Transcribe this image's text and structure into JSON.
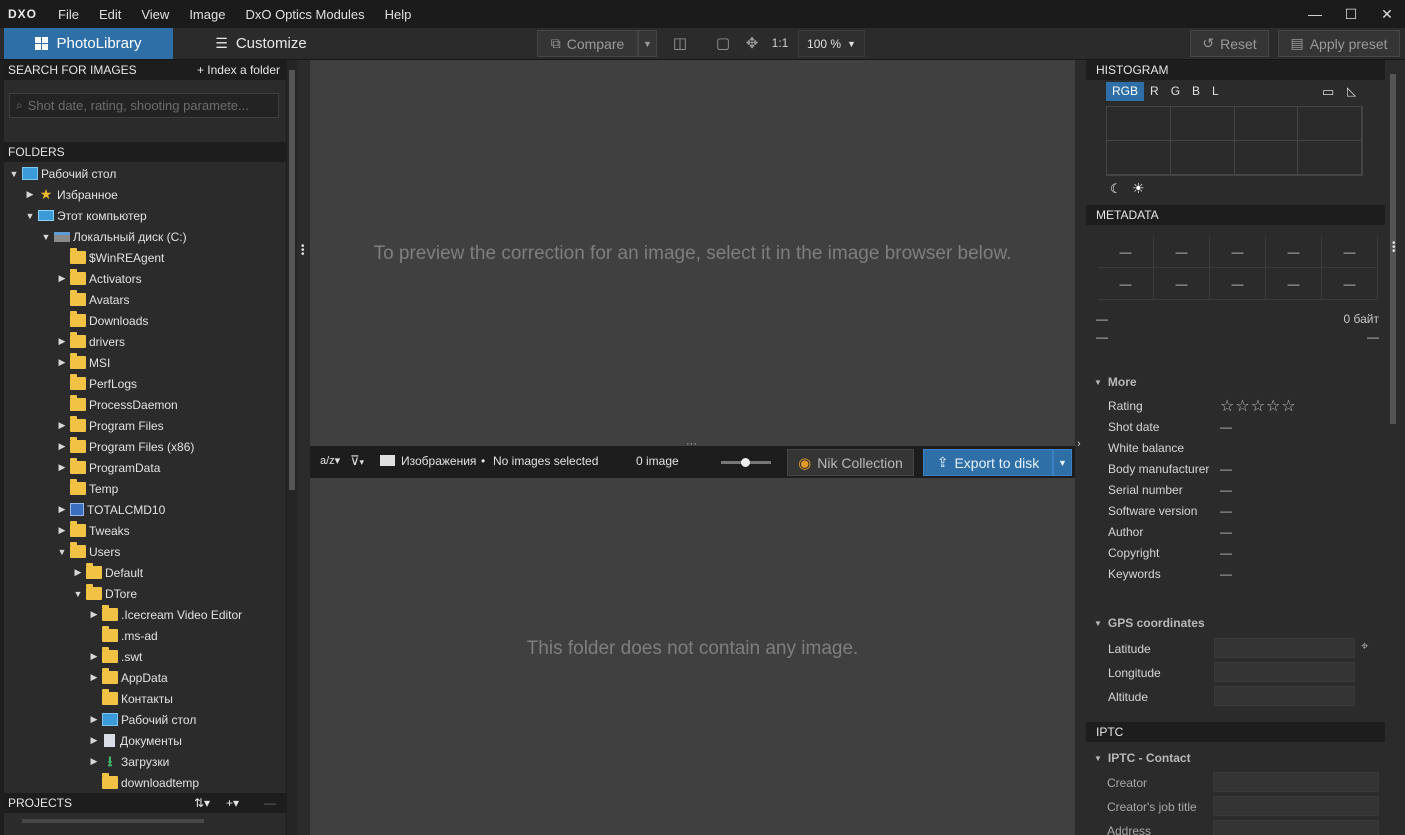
{
  "app": {
    "logo": "DXO"
  },
  "menu": [
    "File",
    "Edit",
    "View",
    "Image",
    "DxO Optics Modules",
    "Help"
  ],
  "window_controls": {
    "minimize": "—",
    "maximize": "☐",
    "close": "✕"
  },
  "toolbar": {
    "tab_photolibrary": "PhotoLibrary",
    "tab_customize": "Customize",
    "compare": "Compare",
    "zoom_1to1": "1:1",
    "zoom_level": "100 %",
    "reset": "Reset",
    "apply_preset": "Apply preset"
  },
  "left": {
    "search_header": "SEARCH FOR IMAGES",
    "index_folder": "+ Index a folder",
    "search_placeholder": "Shot date, rating, shooting paramete...",
    "folders_header": "FOLDERS",
    "tree": [
      {
        "label": "Рабочий стол",
        "indent": 0,
        "toggle": "open",
        "icon": "desktop"
      },
      {
        "label": "Избранное",
        "indent": 1,
        "toggle": "closed",
        "icon": "star"
      },
      {
        "label": "Этот компьютер",
        "indent": 1,
        "toggle": "open",
        "icon": "monitor"
      },
      {
        "label": "Локальный диск (C:)",
        "indent": 2,
        "toggle": "open",
        "icon": "drive"
      },
      {
        "label": "$WinREAgent",
        "indent": 3,
        "toggle": "none",
        "icon": "folder"
      },
      {
        "label": "Activators",
        "indent": 3,
        "toggle": "closed",
        "icon": "folder"
      },
      {
        "label": "Avatars",
        "indent": 3,
        "toggle": "none",
        "icon": "folder"
      },
      {
        "label": "Downloads",
        "indent": 3,
        "toggle": "none",
        "icon": "folder"
      },
      {
        "label": "drivers",
        "indent": 3,
        "toggle": "closed",
        "icon": "folder"
      },
      {
        "label": "MSI",
        "indent": 3,
        "toggle": "closed",
        "icon": "folder"
      },
      {
        "label": "PerfLogs",
        "indent": 3,
        "toggle": "none",
        "icon": "folder"
      },
      {
        "label": "ProcessDaemon",
        "indent": 3,
        "toggle": "none",
        "icon": "folder"
      },
      {
        "label": "Program Files",
        "indent": 3,
        "toggle": "closed",
        "icon": "folder"
      },
      {
        "label": "Program Files (x86)",
        "indent": 3,
        "toggle": "closed",
        "icon": "folder"
      },
      {
        "label": "ProgramData",
        "indent": 3,
        "toggle": "closed",
        "icon": "folder"
      },
      {
        "label": "Temp",
        "indent": 3,
        "toggle": "none",
        "icon": "folder"
      },
      {
        "label": "TOTALCMD10",
        "indent": 3,
        "toggle": "closed",
        "icon": "floppy"
      },
      {
        "label": "Tweaks",
        "indent": 3,
        "toggle": "closed",
        "icon": "folder"
      },
      {
        "label": "Users",
        "indent": 3,
        "toggle": "open",
        "icon": "folder"
      },
      {
        "label": "Default",
        "indent": 4,
        "toggle": "closed",
        "icon": "folder"
      },
      {
        "label": "DTore",
        "indent": 4,
        "toggle": "open",
        "icon": "folder"
      },
      {
        "label": ".Icecream Video Editor",
        "indent": 5,
        "toggle": "closed",
        "icon": "folder"
      },
      {
        "label": ".ms-ad",
        "indent": 5,
        "toggle": "none",
        "icon": "folder"
      },
      {
        "label": ".swt",
        "indent": 5,
        "toggle": "closed",
        "icon": "folder"
      },
      {
        "label": "AppData",
        "indent": 5,
        "toggle": "closed",
        "icon": "folder"
      },
      {
        "label": "Контакты",
        "indent": 5,
        "toggle": "none",
        "icon": "folder"
      },
      {
        "label": "Рабочий стол",
        "indent": 5,
        "toggle": "closed",
        "icon": "desktop"
      },
      {
        "label": "Документы",
        "indent": 5,
        "toggle": "closed",
        "icon": "doc"
      },
      {
        "label": "Загрузки",
        "indent": 5,
        "toggle": "closed",
        "icon": "download"
      },
      {
        "label": "downloadtemp",
        "indent": 5,
        "toggle": "none",
        "icon": "folder"
      }
    ],
    "projects_header": "PROJECTS",
    "projects_sort": "⇅▾",
    "projects_add": "+▾",
    "projects_remove": "—"
  },
  "viewer": {
    "message": "To preview the correction for an image, select it in the image browser below."
  },
  "browser_toolbar": {
    "sort": "a/z▾",
    "filter": "▾",
    "folder_name": "Изображения",
    "bullet": "•",
    "selection": "No images selected",
    "image_count": "0 image",
    "nik": "Nik Collection",
    "export": "Export to disk"
  },
  "browser": {
    "message": "This folder does not contain any image."
  },
  "right": {
    "histogram_header": "HISTOGRAM",
    "hist_tabs": [
      "RGB",
      "R",
      "G",
      "B",
      "L"
    ],
    "metadata_header": "METADATA",
    "meta_grid": [
      "—",
      "—",
      "—",
      "—",
      "—",
      "—",
      "—",
      "—",
      "—",
      "—"
    ],
    "file_name": "—",
    "file_size": "0 байт",
    "dash_left": "—",
    "dash_right": "—",
    "more_header": "More",
    "more_rows": [
      {
        "label": "Rating",
        "value": "☆☆☆☆☆"
      },
      {
        "label": "Shot date",
        "value": "—"
      },
      {
        "label": "White balance",
        "value": ""
      },
      {
        "label": "Body manufacturer",
        "value": "—"
      },
      {
        "label": "Serial number",
        "value": "—"
      },
      {
        "label": "Software version",
        "value": "—"
      },
      {
        "label": "Author",
        "value": "—"
      },
      {
        "label": "Copyright",
        "value": "—"
      },
      {
        "label": "Keywords",
        "value": "—"
      }
    ],
    "gps_header": "GPS coordinates",
    "gps_rows": [
      "Latitude",
      "Longitude",
      "Altitude"
    ],
    "iptc_header": "IPTC",
    "iptc_contact": "IPTC - Contact",
    "iptc_rows": [
      "Creator",
      "Creator's job title",
      "Address"
    ]
  },
  "colors": {
    "accent": "#2f6fa8",
    "folder": "#f2c244",
    "panel": "#2b2b2b",
    "viewer": "#404040"
  }
}
